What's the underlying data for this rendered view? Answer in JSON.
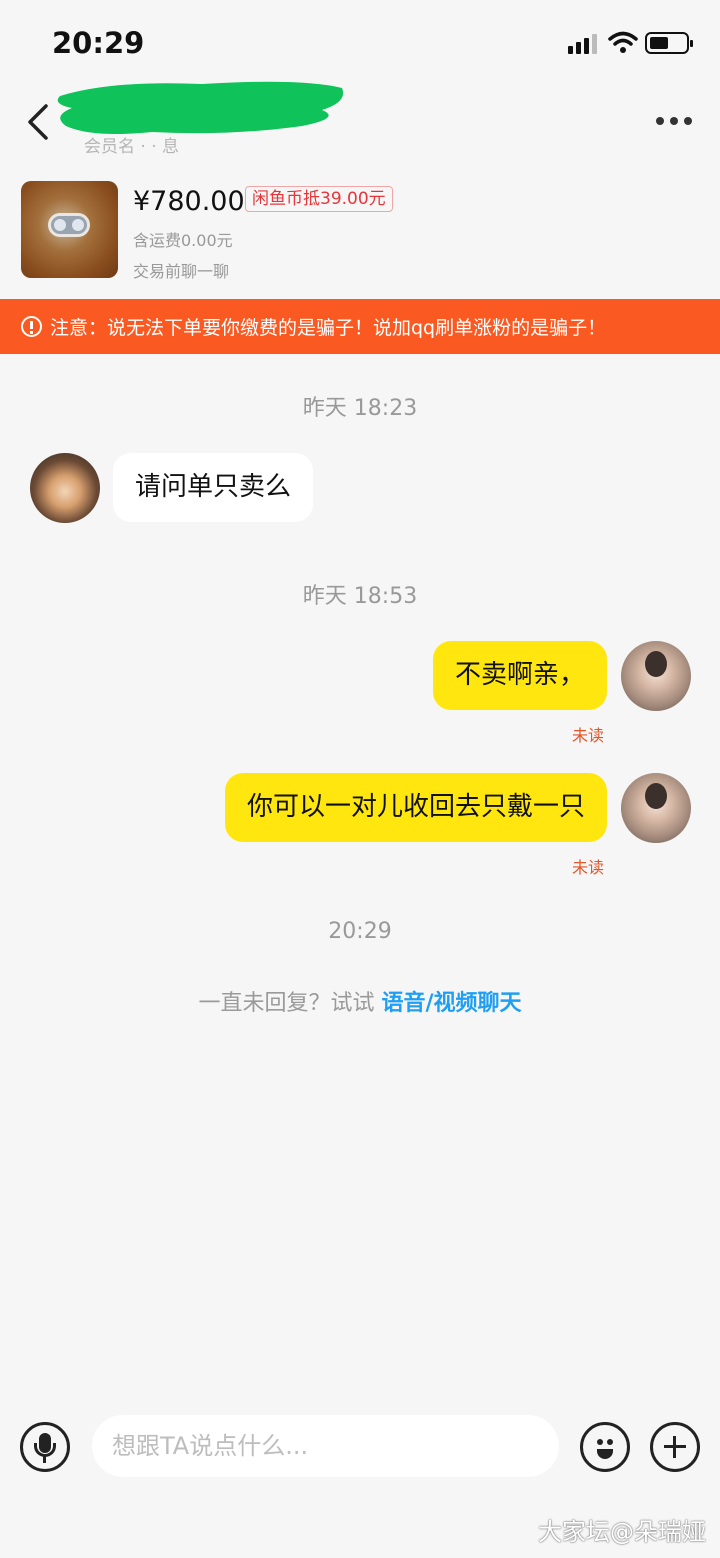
{
  "status_bar": {
    "time": "20:29"
  },
  "header": {
    "subtitle": "会员名 · · 息"
  },
  "product": {
    "price": "¥780.00",
    "coin_discount": "闲鱼币抵39.00元",
    "shipping": "含运费0.00元",
    "note": "交易前聊一聊"
  },
  "warning": {
    "text": "注意：说无法下单要你缴费的是骗子！说加qq刷单涨粉的是骗子！"
  },
  "chat": {
    "timestamps": [
      "昨天 18:23",
      "昨天 18:53",
      "20:29"
    ],
    "messages": [
      {
        "from": "other",
        "text": "请问单只卖么"
      },
      {
        "from": "me",
        "text": "不卖啊亲，",
        "status": "未读"
      },
      {
        "from": "me",
        "text": "你可以一对儿收回去只戴一只",
        "status": "未读"
      }
    ]
  },
  "hint": {
    "prefix": "一直未回复？试试 ",
    "link": "语音/视频聊天"
  },
  "input": {
    "placeholder": "想跟TA说点什么..."
  },
  "watermark": "大家坛@朵瑞娅",
  "colors": {
    "accent_yellow": "#ffe60f",
    "warning_orange": "#fa5a22",
    "link_blue": "#1f9ff3",
    "unread_red": "#e1572c"
  }
}
